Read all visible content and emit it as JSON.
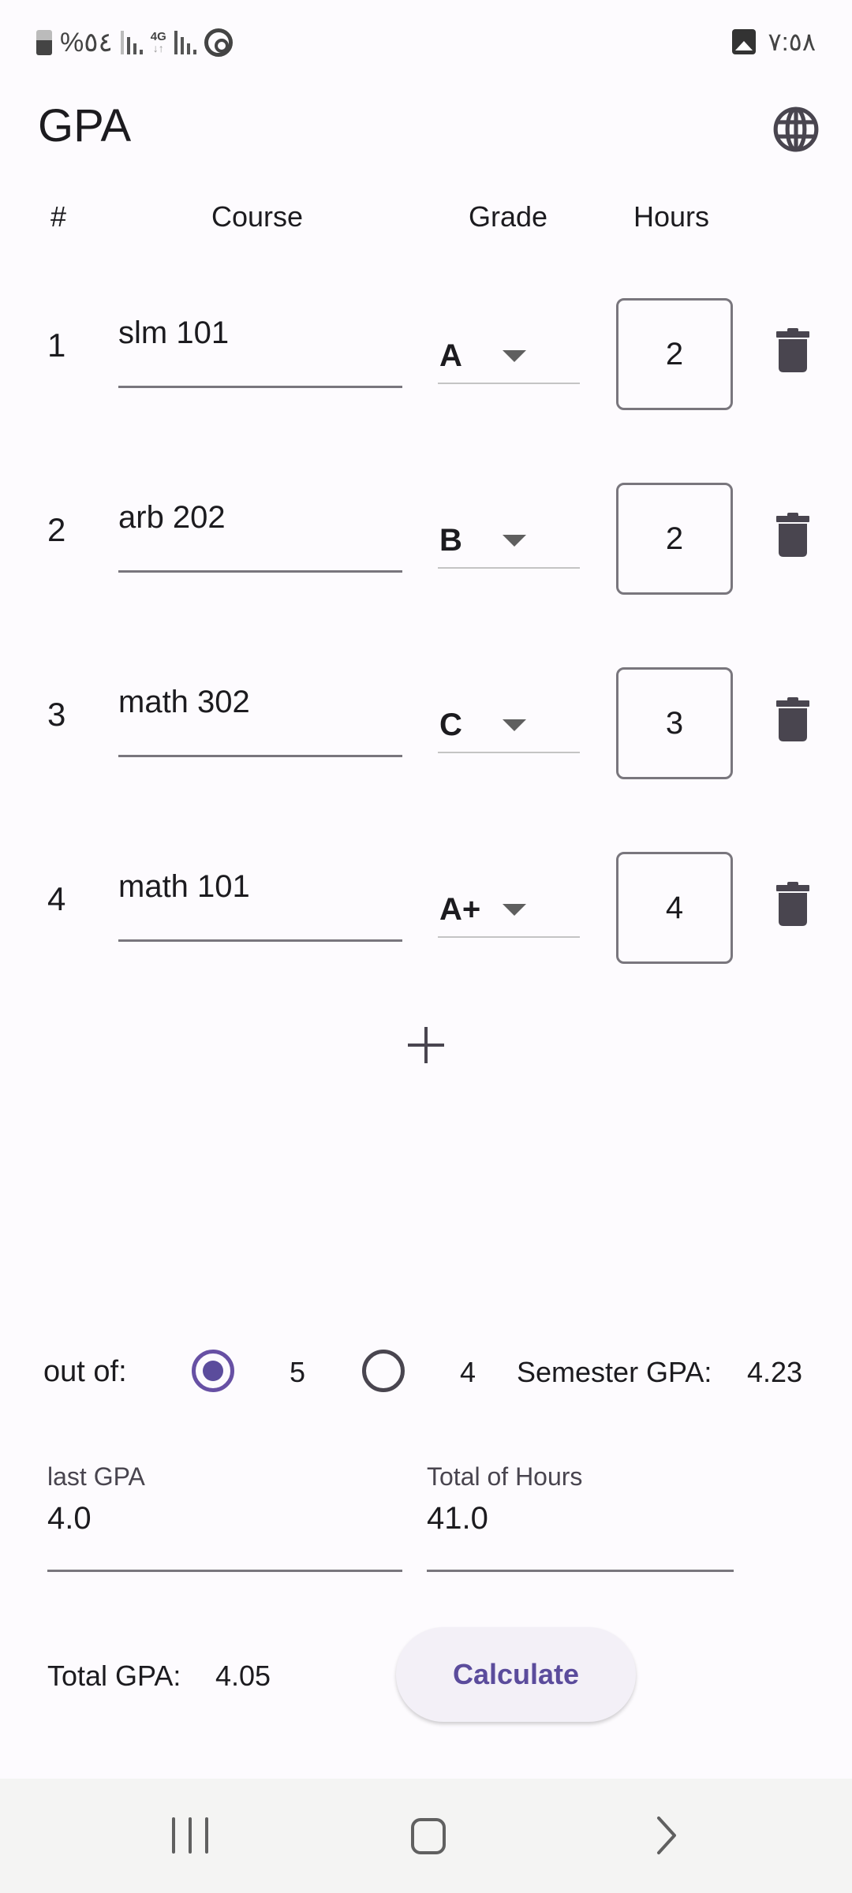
{
  "status_bar": {
    "battery_text": "%٥٤",
    "network_label": "4G",
    "time": "٧:٥٨"
  },
  "app": {
    "title": "GPA",
    "language_icon": "globe-icon"
  },
  "table": {
    "headers": {
      "number": "#",
      "course": "Course",
      "grade": "Grade",
      "hours": "Hours"
    },
    "rows": [
      {
        "num": "1",
        "course": "slm 101",
        "grade": "A",
        "hours": "2"
      },
      {
        "num": "2",
        "course": "arb 202",
        "grade": "B",
        "hours": "2"
      },
      {
        "num": "3",
        "course": "math 302",
        "grade": "C",
        "hours": "3"
      },
      {
        "num": "4",
        "course": "math 101",
        "grade": "A+",
        "hours": "4"
      }
    ],
    "add_icon": "plus-icon",
    "delete_icon": "trash-icon"
  },
  "scale": {
    "label": "out of:",
    "options": [
      {
        "label": "5",
        "selected": true
      },
      {
        "label": "4",
        "selected": false
      }
    ]
  },
  "semester": {
    "label": "Semester GPA:",
    "value": "4.23"
  },
  "fields": {
    "last_gpa": {
      "label": "last GPA",
      "value": "4.0"
    },
    "total_hours": {
      "label": "Total of Hours",
      "value": "41.0"
    }
  },
  "total": {
    "label": "Total GPA:",
    "value": "4.05"
  },
  "actions": {
    "calculate_label": "Calculate"
  },
  "colors": {
    "accent": "#6750a4",
    "button_bg": "#f3f0f7",
    "button_text": "#5b4c9c",
    "background": "#fdfbfe"
  }
}
